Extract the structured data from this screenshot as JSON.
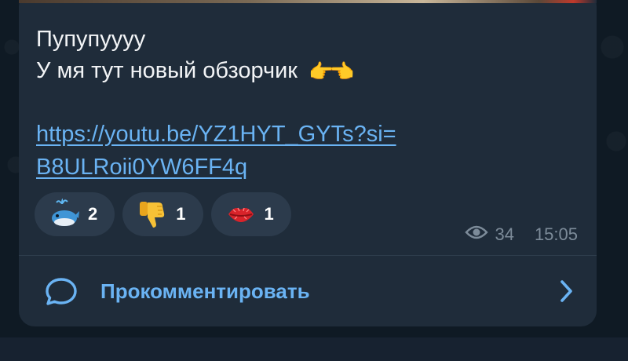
{
  "message": {
    "line1": "Пупупуууу",
    "line2": "У мя тут новый обзорчик",
    "pointer_emoji": "👉👈",
    "link_part1": "https://youtu.be/YZ1HYT_GYTs?si=",
    "link_part2": "B8ULRoii0YW6FF4q"
  },
  "reactions": [
    {
      "icon": "whale-emoji-icon",
      "count": "2"
    },
    {
      "icon": "thumbs-down-emoji-icon",
      "count": "1"
    },
    {
      "icon": "kiss-lips-emoji-icon",
      "count": "1"
    }
  ],
  "meta": {
    "views_icon": "eye-icon",
    "views": "34",
    "time": "15:05"
  },
  "comment": {
    "icon": "speech-bubble-icon",
    "label": "Прокомментировать",
    "chevron_icon": "chevron-right-icon"
  },
  "colors": {
    "bubble": "#1f2c3a",
    "background": "#0f1a24",
    "link": "#6ab3f3",
    "reaction_pill": "#2c3b4c",
    "meta_text": "#7c8b99"
  }
}
